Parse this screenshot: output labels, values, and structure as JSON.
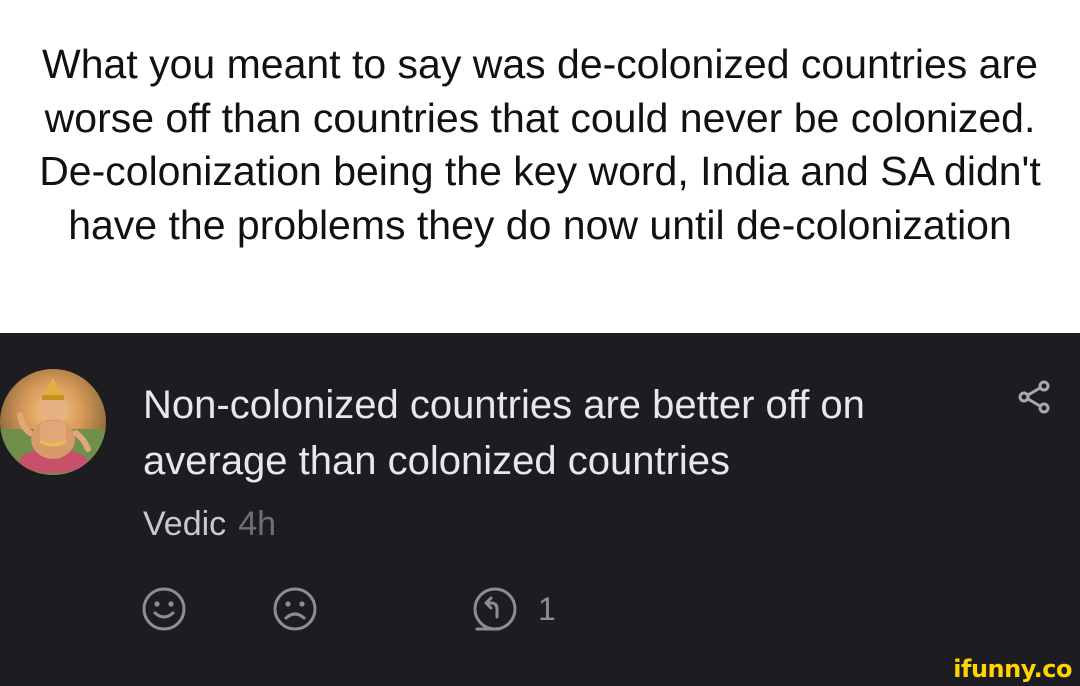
{
  "caption": {
    "text": "What you meant to say was de-colonized countries are worse off than countries that could never be colonized. De-colonization being the key word, India and SA didn't have the problems they do now until de-colonization"
  },
  "post": {
    "avatar_icon": "deity-avatar-icon",
    "text": "Non-colonized countries are better off on average than colonized countries",
    "author": "Vedic",
    "time": "4h",
    "share_icon": "share-icon",
    "actions": {
      "upvote_icon": "smile-icon",
      "downvote_icon": "frown-icon",
      "reply_icon": "reply-icon",
      "reply_count": "1"
    }
  },
  "watermark": "ifunny.co",
  "colors": {
    "panel_bg": "#1c1c21",
    "text_primary": "#e8e8ea",
    "text_secondary": "#6f6f75",
    "watermark": "#ffd400"
  }
}
